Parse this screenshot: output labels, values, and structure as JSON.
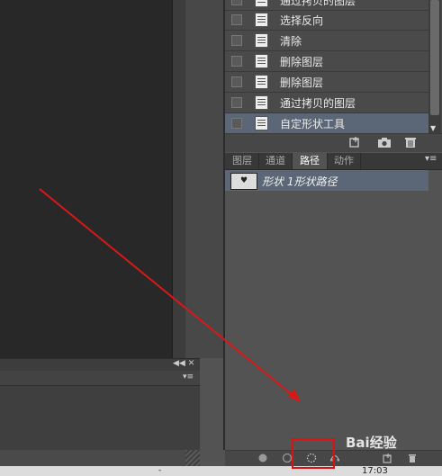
{
  "history": {
    "items": [
      {
        "label": "通过拷贝的图层",
        "selected": false
      },
      {
        "label": "选择反向",
        "selected": false
      },
      {
        "label": "清除",
        "selected": false
      },
      {
        "label": "删除图层",
        "selected": false
      },
      {
        "label": "删除图层",
        "selected": false
      },
      {
        "label": "通过拷贝的图层",
        "selected": false
      },
      {
        "label": "自定形状工具",
        "selected": true
      }
    ]
  },
  "paths_panel": {
    "tabs": [
      {
        "label": "图层",
        "active": false
      },
      {
        "label": "通道",
        "active": false
      },
      {
        "label": "路径",
        "active": true
      },
      {
        "label": "动作",
        "active": false
      }
    ],
    "path_item": {
      "label": "形状 1形状路径",
      "thumb_glyph": "♥"
    }
  },
  "taskbar": {
    "clock": "17:03",
    "mark": "-"
  },
  "watermark": {
    "text": "Bai经验"
  },
  "colors": {
    "selection": "#5b6777",
    "annotation": "#e01010",
    "panel": "#535353"
  },
  "icons": {
    "history_footer": [
      "new-snapshot-icon",
      "camera-icon",
      "trash-icon"
    ],
    "paths_footer": [
      "fill-path-icon",
      "stroke-path-icon",
      "load-selection-icon",
      "make-workpath-icon",
      "new-path-icon",
      "delete-path-icon"
    ]
  }
}
